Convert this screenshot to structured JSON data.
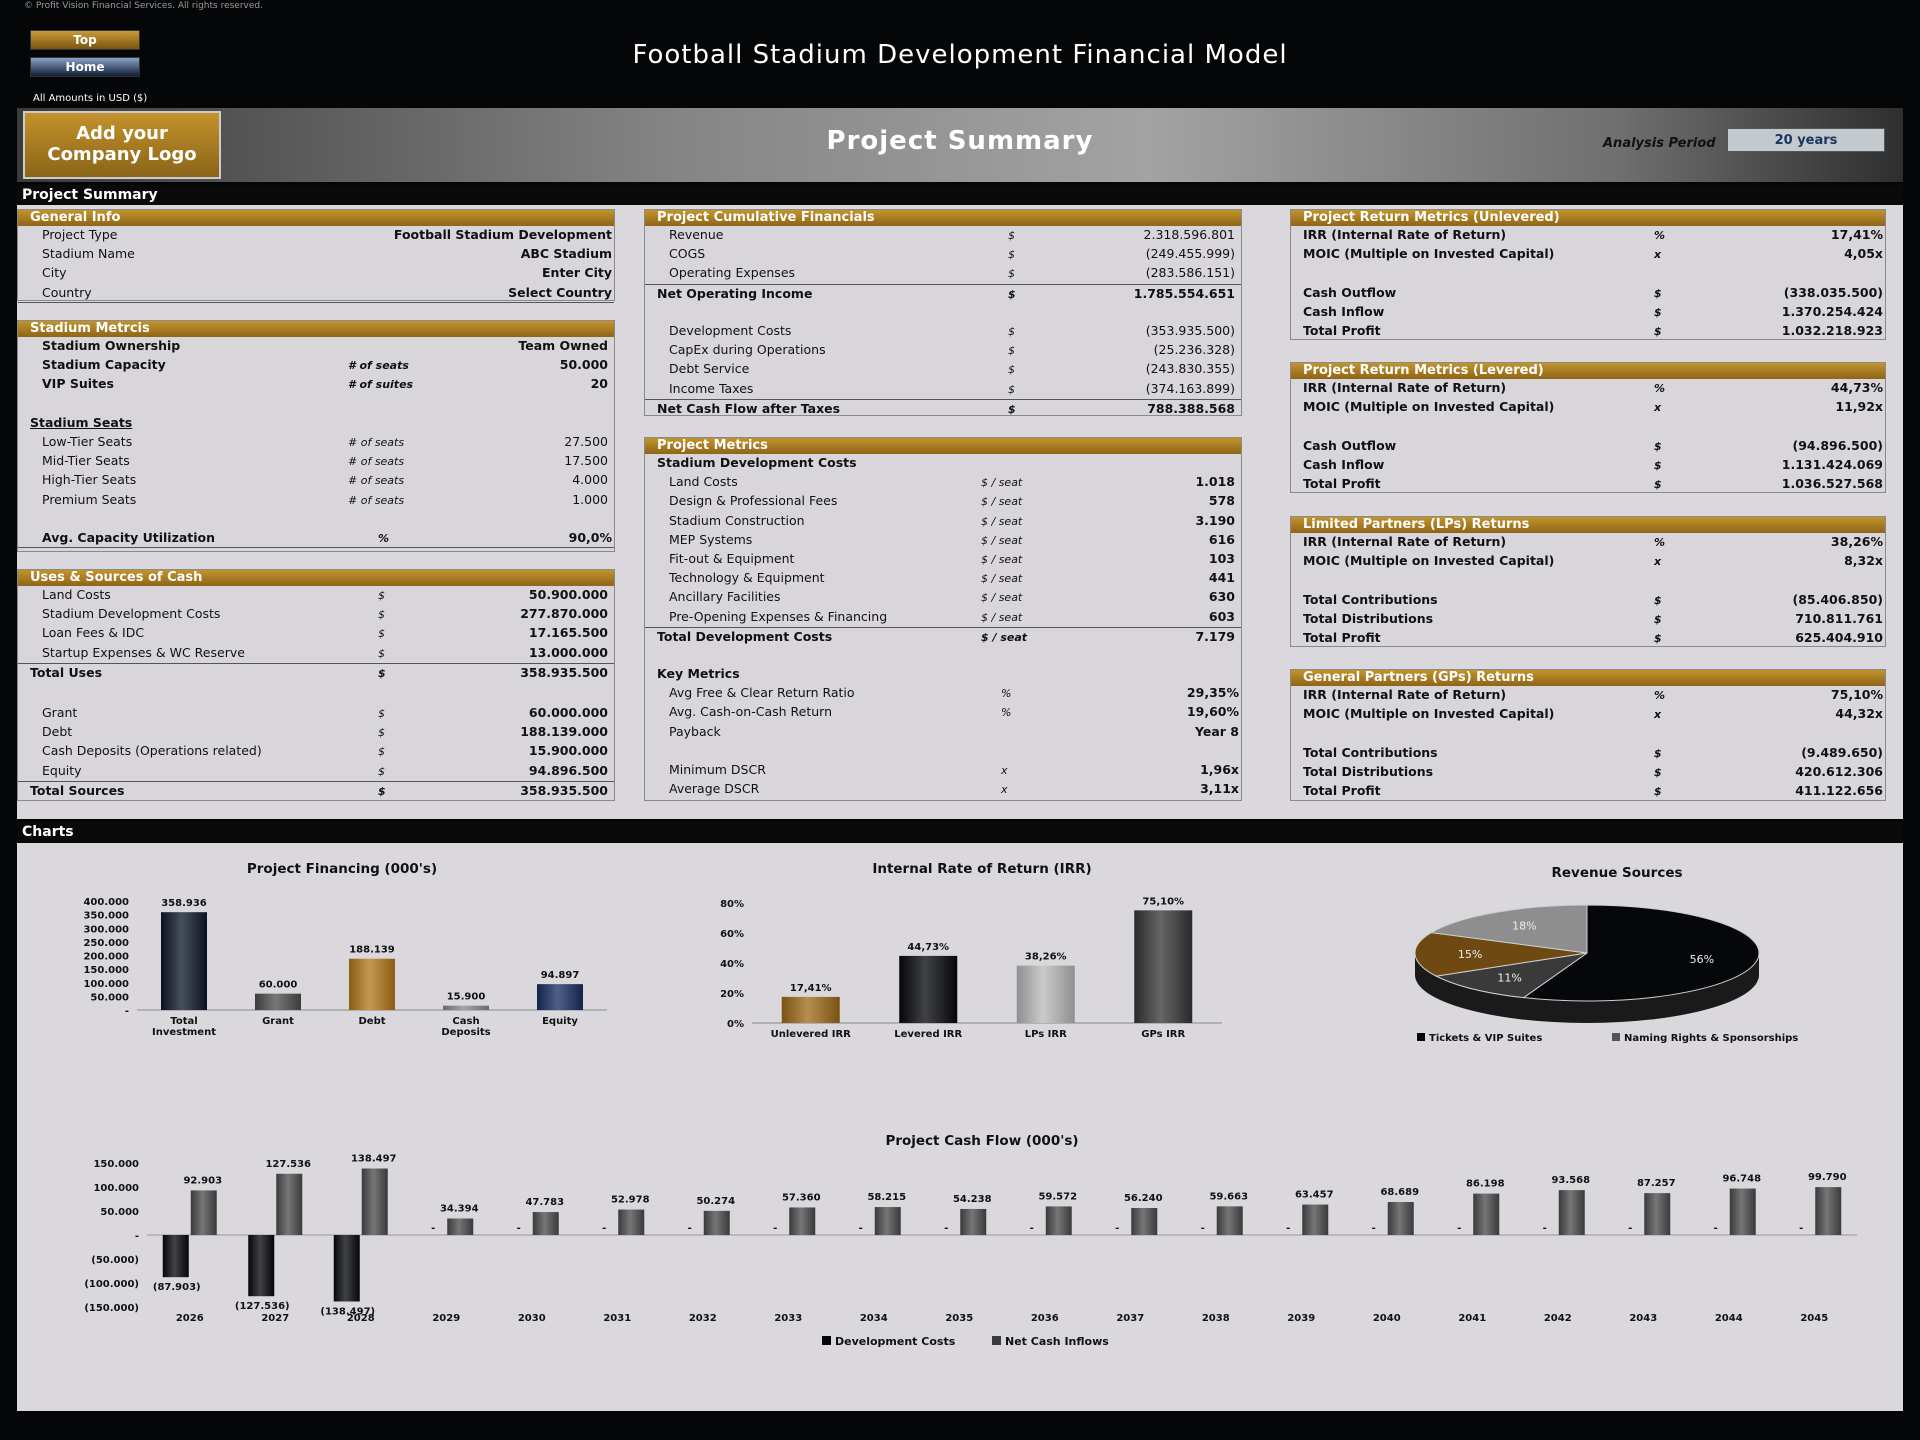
{
  "header": {
    "copyright": "© Profit Vision Financial Services. All rights reserved.",
    "top_button": "Top",
    "home_button": "Home",
    "title": "Football Stadium Development Financial Model",
    "amounts_note": "All Amounts in  USD ($)"
  },
  "banner": {
    "logo_text": "Add your Company Logo",
    "title": "Project Summary",
    "analysis_period_label": "Analysis Period",
    "analysis_period_value": "20 years"
  },
  "sections": {
    "summary": "Project Summary",
    "charts": "Charts"
  },
  "general_info": {
    "title": "General Info",
    "rows": [
      {
        "label": "Project Type",
        "value": "Football Stadium Development"
      },
      {
        "label": "Stadium Name",
        "value": "ABC Stadium"
      },
      {
        "label": "City",
        "value": "Enter City"
      },
      {
        "label": "Country",
        "value": "Select Country"
      }
    ]
  },
  "stadium_metrics": {
    "title": "Stadium Metrcis",
    "rows": [
      {
        "label": "Stadium Ownership",
        "unit": "",
        "value": "Team Owned"
      },
      {
        "label": "Stadium Capacity",
        "unit": "# of seats",
        "value": "50.000"
      },
      {
        "label": "VIP Suites",
        "unit": "# of suites",
        "value": "20"
      }
    ],
    "seats_heading": "Stadium Seats",
    "seats": [
      {
        "label": "Low-Tier Seats",
        "unit": "# of seats",
        "value": "27.500"
      },
      {
        "label": "Mid-Tier Seats",
        "unit": "# of seats",
        "value": "17.500"
      },
      {
        "label": "High-Tier Seats",
        "unit": "# of seats",
        "value": "4.000"
      },
      {
        "label": "Premium Seats",
        "unit": "# of seats",
        "value": "1.000"
      }
    ],
    "utilization": {
      "label": "Avg. Capacity Utilization",
      "unit": "%",
      "value": "90,0%"
    }
  },
  "uses_sources": {
    "title": "Uses & Sources of Cash",
    "uses": [
      {
        "label": "Land Costs",
        "unit": "$",
        "value": "50.900.000"
      },
      {
        "label": "Stadium Development Costs",
        "unit": "$",
        "value": "277.870.000"
      },
      {
        "label": "Loan Fees & IDC",
        "unit": "$",
        "value": "17.165.500"
      },
      {
        "label": "Startup Expenses & WC Reserve",
        "unit": "$",
        "value": "13.000.000"
      }
    ],
    "total_uses": {
      "label": "Total Uses",
      "unit": "$",
      "value": "358.935.500"
    },
    "sources": [
      {
        "label": "Grant",
        "unit": "$",
        "value": "60.000.000"
      },
      {
        "label": "Debt",
        "unit": "$",
        "value": "188.139.000"
      },
      {
        "label": "Cash Deposits (Operations related)",
        "unit": "$",
        "value": "15.900.000"
      },
      {
        "label": "Equity",
        "unit": "$",
        "value": "94.896.500"
      }
    ],
    "total_sources": {
      "label": "Total Sources",
      "unit": "$",
      "value": "358.935.500"
    }
  },
  "cumulative": {
    "title": "Project Cumulative Financials",
    "rows1": [
      {
        "label": "Revenue",
        "unit": "$",
        "value": "2.318.596.801"
      },
      {
        "label": "COGS",
        "unit": "$",
        "value": "(249.455.999)"
      },
      {
        "label": "Operating Expenses",
        "unit": "$",
        "value": "(283.586.151)"
      }
    ],
    "noi": {
      "label": "Net Operating Income",
      "unit": "$",
      "value": "1.785.554.651"
    },
    "rows2": [
      {
        "label": "Development Costs",
        "unit": "$",
        "value": "(353.935.500)"
      },
      {
        "label": "CapEx during Operations",
        "unit": "$",
        "value": "(25.236.328)"
      },
      {
        "label": "Debt Service",
        "unit": "$",
        "value": "(243.830.355)"
      },
      {
        "label": "Income Taxes",
        "unit": "$",
        "value": "(374.163.899)"
      }
    ],
    "ncf": {
      "label": "Net Cash Flow after Taxes",
      "unit": "$",
      "value": "788.388.568"
    }
  },
  "project_metrics": {
    "title": "Project Metrics",
    "dev_heading": "Stadium Development Costs",
    "dev": [
      {
        "label": "Land Costs",
        "unit": "$ / seat",
        "value": "1.018"
      },
      {
        "label": "Design & Professional Fees",
        "unit": "$ / seat",
        "value": "578"
      },
      {
        "label": "Stadium Construction",
        "unit": "$ / seat",
        "value": "3.190"
      },
      {
        "label": "MEP Systems",
        "unit": "$ / seat",
        "value": "616"
      },
      {
        "label": "Fit-out & Equipment",
        "unit": "$ / seat",
        "value": "103"
      },
      {
        "label": "Technology & Equipment",
        "unit": "$ / seat",
        "value": "441"
      },
      {
        "label": "Ancillary Facilities",
        "unit": "$ / seat",
        "value": "630"
      },
      {
        "label": "Pre-Opening Expenses & Financing",
        "unit": "$ / seat",
        "value": "603"
      }
    ],
    "dev_total": {
      "label": "Total Development Costs",
      "unit": "$ / seat",
      "value": "7.179"
    },
    "key_heading": "Key Metrics",
    "key": [
      {
        "label": "Avg Free & Clear Return Ratio",
        "unit": "%",
        "value": "29,35%"
      },
      {
        "label": "Avg. Cash-on-Cash Return",
        "unit": "%",
        "value": "19,60%"
      },
      {
        "label": "Payback",
        "unit": "",
        "value": "Year 8"
      }
    ],
    "dscr": [
      {
        "label": "Minimum DSCR",
        "unit": "x",
        "value": "1,96x"
      },
      {
        "label": "Average DSCR",
        "unit": "x",
        "value": "3,11x"
      }
    ]
  },
  "unlevered": {
    "title": "Project Return Metrics (Unlevered)",
    "irr": {
      "label": "IRR (Internal Rate of Return)",
      "unit": "%",
      "value": "17,41%"
    },
    "moic": {
      "label": "MOIC (Multiple on Invested Capital)",
      "unit": "x",
      "value": "4,05x"
    },
    "rows": [
      {
        "label": "Cash Outflow",
        "unit": "$",
        "value": "(338.035.500)"
      },
      {
        "label": "Cash Inflow",
        "unit": "$",
        "value": "1.370.254.424"
      },
      {
        "label": "Total Profit",
        "unit": "$",
        "value": "1.032.218.923"
      }
    ]
  },
  "levered": {
    "title": "Project Return Metrics (Levered)",
    "irr": {
      "label": "IRR (Internal Rate of Return)",
      "unit": "%",
      "value": "44,73%"
    },
    "moic": {
      "label": "MOIC (Multiple on Invested Capital)",
      "unit": "x",
      "value": "11,92x"
    },
    "rows": [
      {
        "label": "Cash Outflow",
        "unit": "$",
        "value": "(94.896.500)"
      },
      {
        "label": "Cash Inflow",
        "unit": "$",
        "value": "1.131.424.069"
      },
      {
        "label": "Total Profit",
        "unit": "$",
        "value": "1.036.527.568"
      }
    ]
  },
  "lps": {
    "title": "Limited Partners (LPs) Returns",
    "irr": {
      "label": "IRR (Internal Rate of Return)",
      "unit": "%",
      "value": "38,26%"
    },
    "moic": {
      "label": "MOIC (Multiple on Invested Capital)",
      "unit": "x",
      "value": "8,32x"
    },
    "rows": [
      {
        "label": "Total Contributions",
        "unit": "$",
        "value": "(85.406.850)"
      },
      {
        "label": "Total Distributions",
        "unit": "$",
        "value": "710.811.761"
      },
      {
        "label": "Total Profit",
        "unit": "$",
        "value": "625.404.910"
      }
    ]
  },
  "gps": {
    "title": "General Partners (GPs) Returns",
    "irr": {
      "label": "IRR (Internal Rate of Return)",
      "unit": "%",
      "value": "75,10%"
    },
    "moic": {
      "label": "MOIC (Multiple on Invested Capital)",
      "unit": "x",
      "value": "44,32x"
    },
    "rows": [
      {
        "label": "Total Contributions",
        "unit": "$",
        "value": "(9.489.650)"
      },
      {
        "label": "Total Distributions",
        "unit": "$",
        "value": "420.612.306"
      },
      {
        "label": "Total Profit",
        "unit": "$",
        "value": "411.122.656"
      }
    ]
  },
  "chart_data": [
    {
      "type": "bar",
      "title": "Project Financing (000's)",
      "categories": [
        "Total Investment",
        "Grant",
        "Debt",
        "Cash Deposits",
        "Equity"
      ],
      "values": [
        358936,
        60000,
        188139,
        15900,
        94897
      ],
      "value_labels": [
        "358.936",
        "60.000",
        "188.139",
        "15.900",
        "94.897"
      ],
      "ylim": [
        0,
        400000
      ],
      "yticks": [
        "-",
        "50.000",
        "100.000",
        "150.000",
        "200.000",
        "250.000",
        "300.000",
        "350.000",
        "400.000"
      ],
      "colors": [
        "#0b1220",
        "#3c3c3c",
        "#8a5c14",
        "#6a6a6a",
        "#12244a"
      ]
    },
    {
      "type": "bar",
      "title": "Internal Rate of Return (IRR)",
      "categories": [
        "Unlevered IRR",
        "Levered IRR",
        "LPs IRR",
        "GPs IRR"
      ],
      "values": [
        17.41,
        44.73,
        38.26,
        75.1
      ],
      "value_labels": [
        "17,41%",
        "44,73%",
        "38,26%",
        "75,10%"
      ],
      "ylim": [
        0,
        80
      ],
      "yticks": [
        "0%",
        "20%",
        "40%",
        "60%",
        "80%"
      ],
      "colors": [
        "#7a5214",
        "#050608",
        "#8f8f8f",
        "#2a2a2a"
      ]
    },
    {
      "type": "pie",
      "title": "Revenue Sources",
      "values": [
        56,
        11,
        15,
        18
      ],
      "value_labels": [
        "56%",
        "11%",
        "15%",
        "18%"
      ],
      "colors": [
        "#06070b",
        "#3a3a3a",
        "#6e4a12",
        "#8e8e8e"
      ],
      "legend": [
        "Tickets & VIP Suites",
        "Naming Rights & Sponsorships"
      ],
      "legend_colors": [
        "#06070b",
        "#555555"
      ]
    },
    {
      "type": "bar",
      "title": "Project Cash Flow (000's)",
      "categories": [
        "2026",
        "2027",
        "2028",
        "2029",
        "2030",
        "2031",
        "2032",
        "2033",
        "2034",
        "2035",
        "2036",
        "2037",
        "2038",
        "2039",
        "2040",
        "2041",
        "2042",
        "2043",
        "2044",
        "2045"
      ],
      "series": [
        {
          "name": "Development Costs",
          "values": [
            -87903,
            -127536,
            -138497,
            0,
            0,
            0,
            0,
            0,
            0,
            0,
            0,
            0,
            0,
            0,
            0,
            0,
            0,
            0,
            0,
            0
          ],
          "value_labels": [
            "(87.903)",
            "(127.536)",
            "(138.497)",
            "-",
            "-",
            "-",
            "-",
            "-",
            "-",
            "-",
            "-",
            "-",
            "-",
            "-",
            "-",
            "-",
            "-",
            "-",
            "-",
            "-"
          ],
          "color": "#050608"
        },
        {
          "name": "Net Cash Inflows",
          "values": [
            92903,
            127536,
            138497,
            34394,
            47783,
            52978,
            50274,
            57360,
            58215,
            54238,
            59572,
            56240,
            59663,
            63457,
            68689,
            86198,
            93568,
            87257,
            96748,
            99790
          ],
          "value_labels": [
            "92.903",
            "127.536",
            "138.497",
            "34.394",
            "47.783",
            "52.978",
            "50.274",
            "57.360",
            "58.215",
            "54.238",
            "59.572",
            "56.240",
            "59.663",
            "63.457",
            "68.689",
            "86.198",
            "93.568",
            "87.257",
            "96.748",
            "99.790"
          ],
          "color": "#3a3a3a"
        }
      ],
      "ylim": [
        -150000,
        150000
      ],
      "yticks": [
        "(150.000)",
        "(100.000)",
        "(50.000)",
        "-",
        "50.000",
        "100.000",
        "150.000"
      ]
    }
  ]
}
